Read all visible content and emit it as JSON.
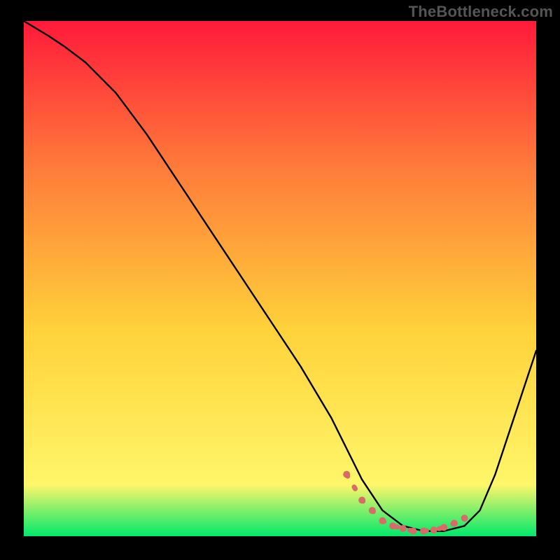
{
  "watermark": "TheBottleneck.com",
  "colors": {
    "background": "#000000",
    "gradient_top": "#ff1a3a",
    "gradient_mid_upper": "#ff7a3a",
    "gradient_mid": "#ffd23a",
    "gradient_mid_lower": "#fff66a",
    "gradient_bottom": "#00e86b",
    "curve": "#000000",
    "marker_fill": "#d86a67",
    "marker_stroke": "#d86a67"
  },
  "chart_data": {
    "type": "line",
    "title": "",
    "xlabel": "",
    "ylabel": "",
    "xlim": [
      0,
      100
    ],
    "ylim": [
      0,
      100
    ],
    "grid": false,
    "series": [
      {
        "name": "bottleneck-curve",
        "x": [
          0,
          5,
          8,
          12,
          18,
          24,
          30,
          36,
          42,
          48,
          54,
          60,
          63,
          66,
          70,
          74,
          78,
          82,
          86,
          89,
          92,
          95,
          100
        ],
        "y": [
          100,
          97,
          95,
          92,
          86,
          78,
          69,
          60,
          51,
          42,
          33,
          23,
          17,
          11,
          5,
          2,
          1,
          1,
          2,
          5,
          12,
          21,
          36
        ]
      }
    ],
    "markers": {
      "name": "highlight-band",
      "x": [
        63,
        66,
        68,
        70,
        72,
        74,
        76,
        78,
        80,
        82,
        84,
        86
      ],
      "y": [
        12,
        7,
        5,
        3,
        2,
        1.5,
        1,
        1,
        1.2,
        1.7,
        2.5,
        3.5
      ]
    }
  }
}
